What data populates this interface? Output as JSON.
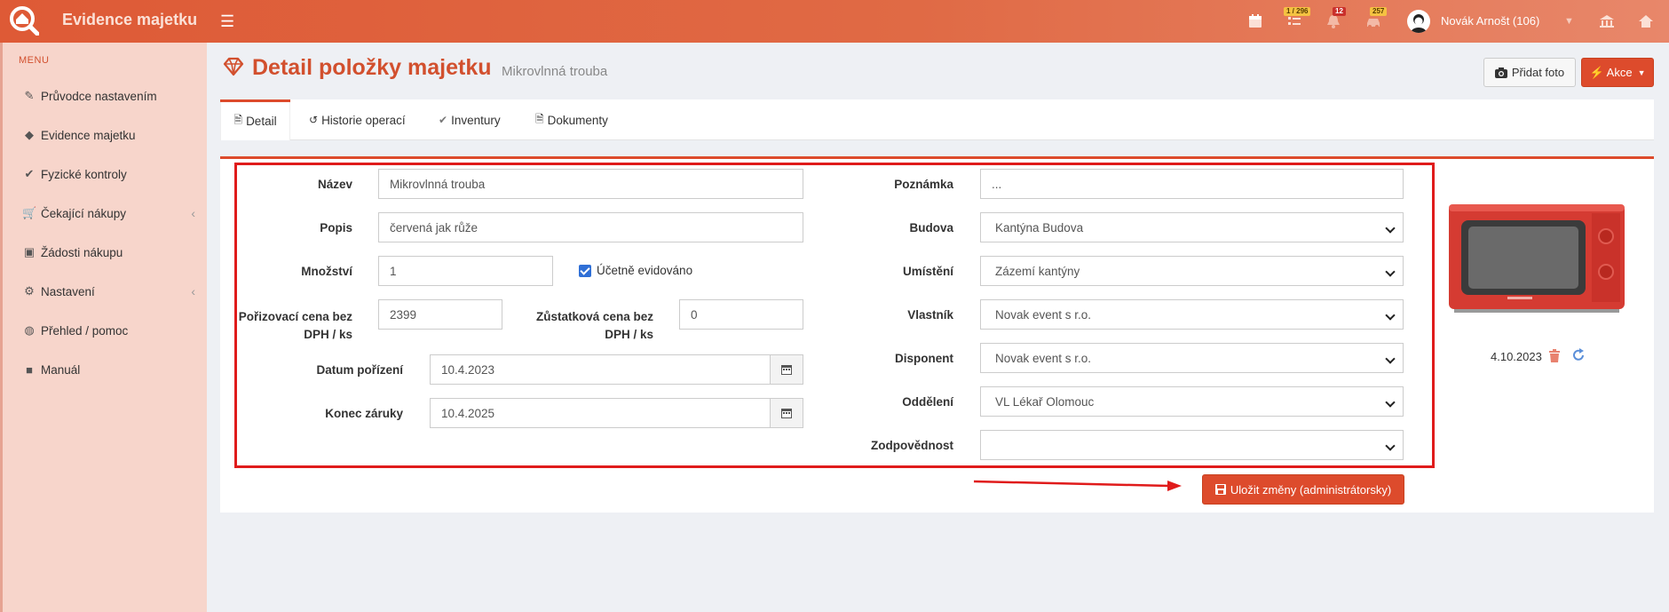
{
  "app": {
    "title": "Evidence majetku",
    "badges": {
      "tasks": "1 / 296",
      "notifications": "12",
      "cars": "257"
    },
    "user": "Novák Arnošt (106)"
  },
  "sidebar": {
    "header": "MENU",
    "items": [
      {
        "label": "Průvodce nastavením",
        "icon": "pencil-icon"
      },
      {
        "label": "Evidence majetku",
        "icon": "diamond-icon"
      },
      {
        "label": "Fyzické kontroly",
        "icon": "check-circle-icon"
      },
      {
        "label": "Čekající nákupy",
        "icon": "cart-icon"
      },
      {
        "label": "Žádosti nákupu",
        "icon": "edit-square-icon"
      },
      {
        "label": "Nastavení",
        "icon": "gears-icon"
      },
      {
        "label": "Přehled / pomoc",
        "icon": "globe-icon"
      },
      {
        "label": "Manuál",
        "icon": "book-icon"
      }
    ]
  },
  "page": {
    "title": "Detail položky majetku",
    "subtitle": "Mikrovlnná trouba",
    "add_photo": "Přidat foto",
    "actions": "Akce"
  },
  "tabs": [
    {
      "label": "Detail"
    },
    {
      "label": "Historie operací"
    },
    {
      "label": "Inventury"
    },
    {
      "label": "Dokumenty"
    }
  ],
  "form": {
    "nazev": {
      "label": "Název",
      "value": "Mikrovlnná trouba"
    },
    "popis": {
      "label": "Popis",
      "value": "červená jak růže"
    },
    "mnozstvi": {
      "label": "Množství",
      "value": "1"
    },
    "ucetne": {
      "label": "Účetně evidováno",
      "checked": true
    },
    "cena_label": [
      "Pořizovací cena bez",
      "DPH / ks"
    ],
    "cena_value": "2399",
    "zustatkova_label": [
      "Zůstatková cena bez",
      "DPH / ks"
    ],
    "zustatkova_value": "0",
    "datum": {
      "label": "Datum pořízení",
      "value": "10.4.2023"
    },
    "zaruka": {
      "label": "Konec záruky",
      "value": "10.4.2025"
    },
    "poznamka": {
      "label": "Poznámka",
      "value": "..."
    },
    "budova": {
      "label": "Budova",
      "value": "Kantýna Budova"
    },
    "umisteni": {
      "label": "Umístění",
      "value": "Zázemí kantýny"
    },
    "vlastnik": {
      "label": "Vlastník",
      "value": "Novak event s r.o."
    },
    "disponent": {
      "label": "Disponent",
      "value": "Novak event s r.o."
    },
    "oddeleni": {
      "label": "Oddělení",
      "value": "VL Lékař Olomouc"
    },
    "zodpovednost": {
      "label": "Zodpovědnost",
      "value": ""
    }
  },
  "photo": {
    "date": "4.10.2023"
  },
  "save_button": "Uložit změny (administrátorsky)",
  "colors": {
    "accent": "#dd4b2c",
    "highlight": "#e01b1b",
    "sidebar": "#f7d5cb"
  }
}
